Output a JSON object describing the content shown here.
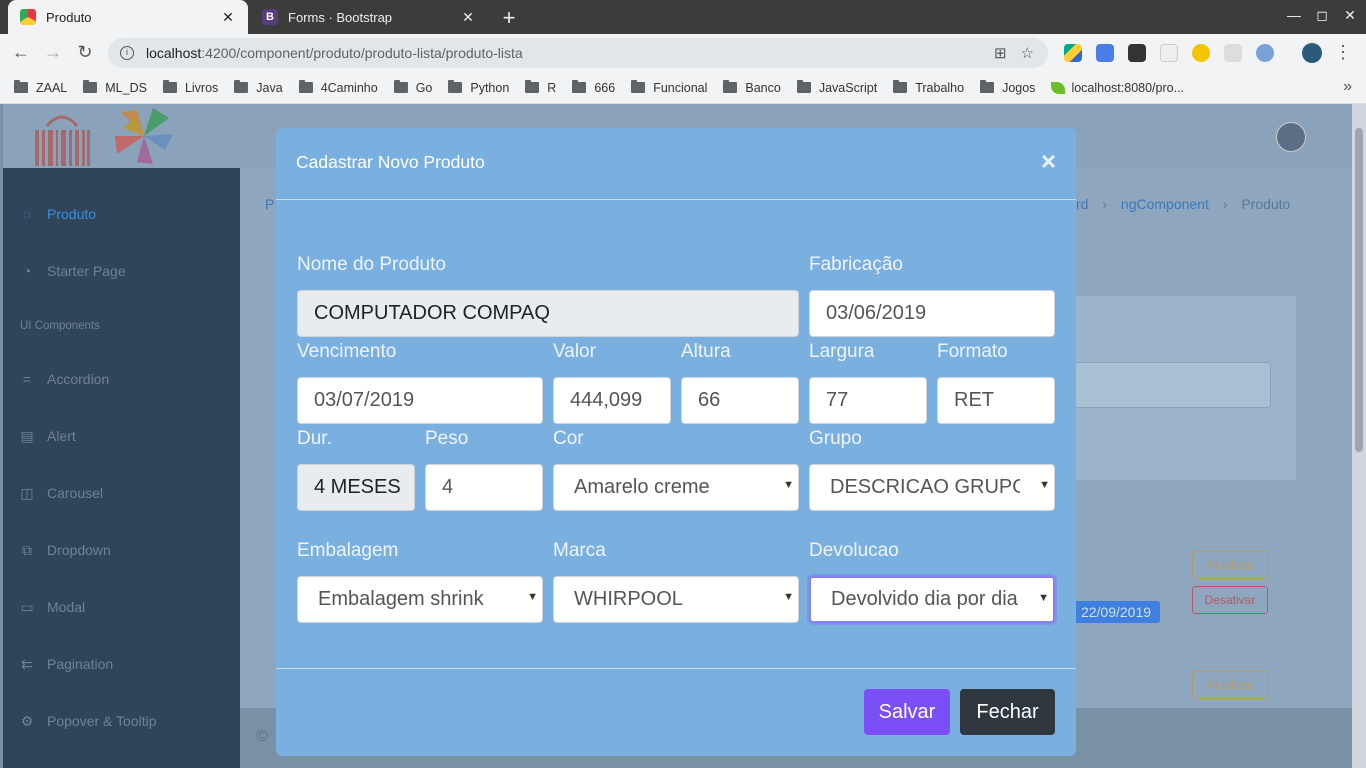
{
  "browser": {
    "tabs": [
      {
        "title": "Produto",
        "active": true
      },
      {
        "title": "Forms · Bootstrap",
        "active": false
      }
    ],
    "url_host": "localhost",
    "url_path": ":4200/component/produto/produto-lista/produto-lista",
    "bookmarks": [
      "ZAAL",
      "ML_DS",
      "Livros",
      "Java",
      "4Caminho",
      "Go",
      "Python",
      "R",
      "666",
      "Funcional",
      "Banco",
      "JavaScript",
      "Trabalho",
      "Jogos"
    ],
    "bookmark_link": "localhost:8080/pro...",
    "more": "»"
  },
  "sidebar": {
    "items": [
      {
        "label": "Produto",
        "icon": "circle-dots-icon",
        "glyph": "◌"
      },
      {
        "label": "Starter Page",
        "icon": "gauge-icon",
        "glyph": "◔"
      },
      {
        "label": "Accordion",
        "icon": "equals-icon",
        "glyph": "="
      },
      {
        "label": "Alert",
        "icon": "message-icon",
        "glyph": "▤"
      },
      {
        "label": "Carousel",
        "icon": "carousel-icon",
        "glyph": "◫"
      },
      {
        "label": "Dropdown",
        "icon": "dropdown-icon",
        "glyph": "⧉"
      },
      {
        "label": "Modal",
        "icon": "modal-icon",
        "glyph": "▭"
      },
      {
        "label": "Pagination",
        "icon": "pagination-icon",
        "glyph": "⇇"
      },
      {
        "label": "Popover & Tooltip",
        "icon": "gear-icon",
        "glyph": "⚙"
      }
    ],
    "heading": "UI Components"
  },
  "breadcrumb": {
    "first": "P",
    "partial": "rd",
    "items": [
      "ngComponent",
      "Produto"
    ],
    "sep": "›"
  },
  "background": {
    "btn_update_1": "Atualizar",
    "btn_deactivate": "Desativar",
    "btn_update_2": "Atualizar",
    "date_badge": "22/09/2019",
    "footer_symbol": "©"
  },
  "modal": {
    "title": "Cadastrar Novo Produto",
    "close_symbol": "×",
    "fields": {
      "nome": {
        "label": "Nome do Produto",
        "value": "COMPUTADOR COMPAQ"
      },
      "fabricacao": {
        "label": "Fabricação",
        "value": "03/06/2019"
      },
      "vencimento": {
        "label": "Vencimento",
        "value": "03/07/2019"
      },
      "valor": {
        "label": "Valor",
        "value": "444,099"
      },
      "altura": {
        "label": "Altura",
        "value": "66"
      },
      "largura": {
        "label": "Largura",
        "value": "77"
      },
      "formato": {
        "label": "Formato",
        "value": "RET"
      },
      "dur": {
        "label": "Dur.",
        "value": "4 MESES"
      },
      "peso": {
        "label": "Peso",
        "value": "4"
      },
      "cor": {
        "label": "Cor",
        "value": "Amarelo creme"
      },
      "grupo": {
        "label": "Grupo",
        "value": "DESCRICAO GRUPO"
      },
      "embalagem": {
        "label": "Embalagem",
        "value": "Embalagem shrink"
      },
      "marca": {
        "label": "Marca",
        "value": "WHIRPOOL"
      },
      "devolucao": {
        "label": "Devolucao",
        "value": "Devolvido dia por dia"
      }
    },
    "save_label": "Salvar",
    "close_label": "Fechar"
  },
  "colors": {
    "modal_bg": "#7ab0e0",
    "save": "#7a4ff5",
    "close": "#30383f",
    "active_link": "#3c8dde"
  }
}
